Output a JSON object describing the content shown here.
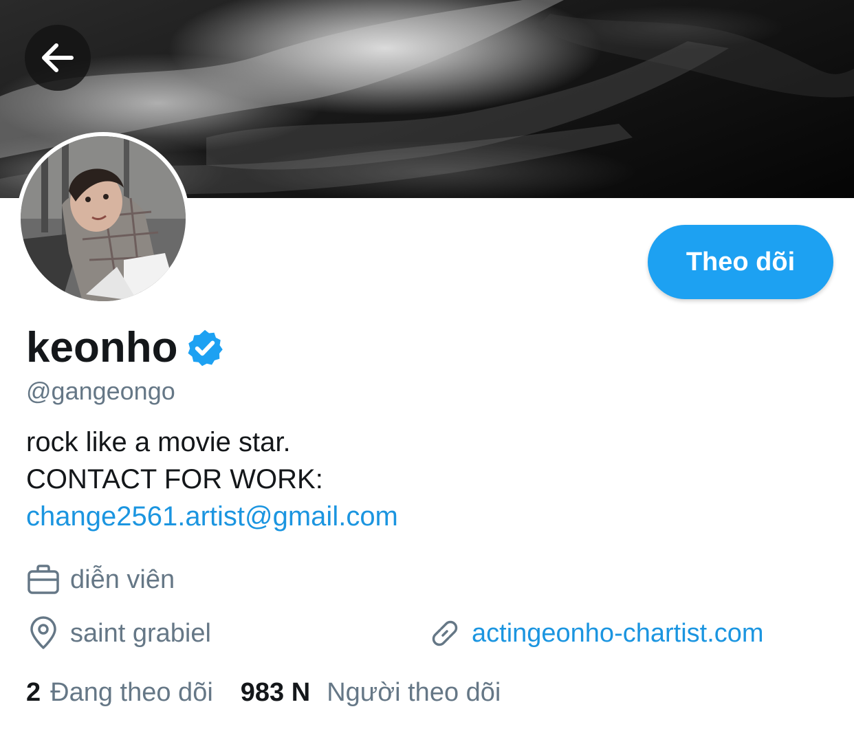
{
  "header": {
    "back_icon": "arrow-left-icon"
  },
  "profile": {
    "display_name": "keonho",
    "verified_icon": "verified-badge-icon",
    "handle": "@gangeongo",
    "bio_line1": "rock like a movie star.",
    "bio_line2": "CONTACT FOR WORK:",
    "bio_email": "change2561.artist@gmail.com",
    "profession": "diễn viên",
    "location": "saint grabiel",
    "website": "actingeonho-chartist.com",
    "following_count": "2",
    "following_label": "Đang theo dõi",
    "followers_count": "983 N",
    "followers_label": "Người theo dõi"
  },
  "actions": {
    "follow_label": "Theo dõi"
  },
  "colors": {
    "accent": "#1da1f2",
    "link": "#1b95e0",
    "text_primary": "#14171a",
    "text_secondary": "#657786"
  }
}
